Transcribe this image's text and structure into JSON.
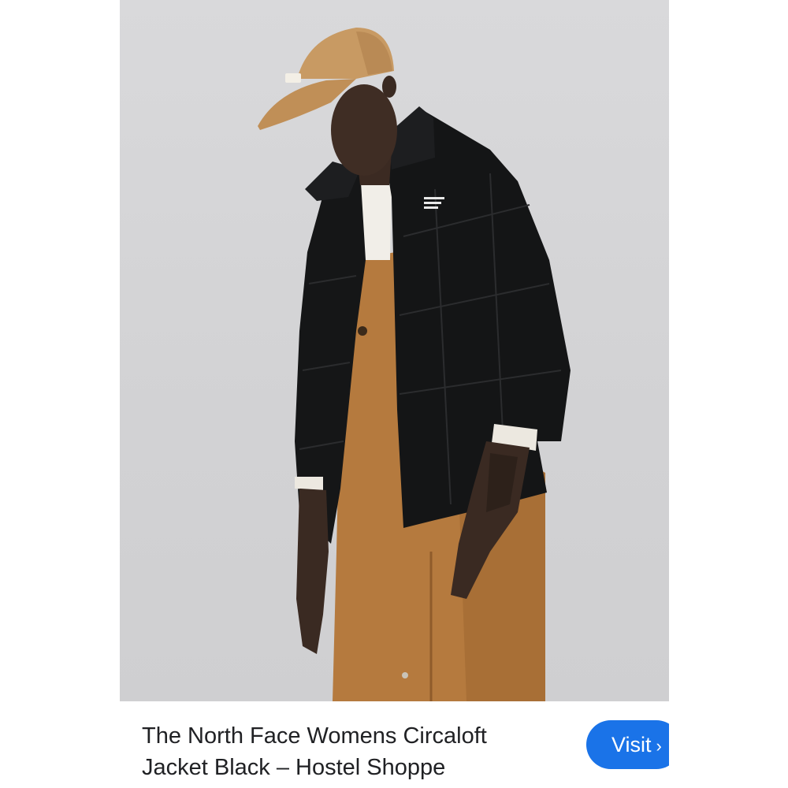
{
  "product": {
    "title_line1": "The North Face Womens Circaloft",
    "title_line2": "Jacket Black – Hostel Shoppe",
    "image_alt": "The North Face Womens Circaloft Jacket Black"
  },
  "actions": {
    "visit_label": "Visit",
    "visit_icon": "chevron-right-icon"
  },
  "colors": {
    "background": "#d3d3d5",
    "visit_button": "#1a73e8",
    "jacket": "#141516",
    "overalls": "#b57a3e",
    "cap": "#c89a63"
  }
}
